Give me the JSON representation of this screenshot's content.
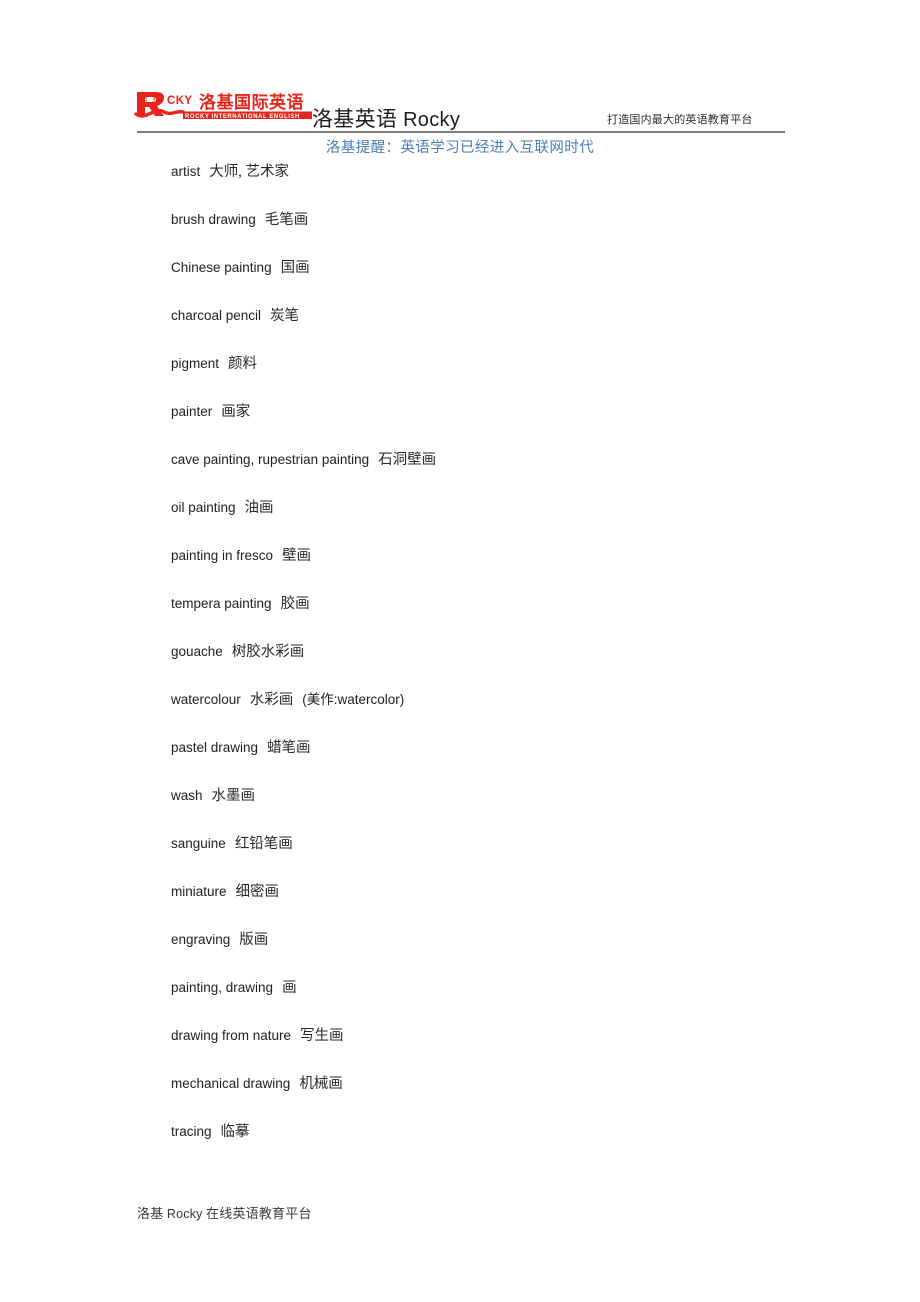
{
  "header": {
    "logo": {
      "icon": "rocky-logo-icon",
      "mark_letter": "R",
      "mark_suffix": "CKY",
      "chinese": "洛基国际英语",
      "english": "ROCKY INTERNATIONAL ENGLISH",
      "color": "#e8251c"
    },
    "brand_title_cn": "洛基英语",
    "brand_title_en": "Rocky",
    "tagline": "打造国内最大的英语教育平台",
    "subtitle": "洛基提醒：英语学习已经进入互联网时代",
    "subtitle_color": "#4a7fb5",
    "rule_color": "#7b7b78"
  },
  "entries": [
    {
      "en": "artist",
      "zh": "大师, 艺术家",
      "note": ""
    },
    {
      "en": "brush drawing",
      "zh": "毛笔画",
      "note": ""
    },
    {
      "en": "Chinese painting",
      "zh": "国画",
      "note": ""
    },
    {
      "en": "charcoal pencil",
      "zh": "炭笔",
      "note": ""
    },
    {
      "en": "pigment",
      "zh": "颜料",
      "note": ""
    },
    {
      "en": "painter",
      "zh": "画家",
      "note": ""
    },
    {
      "en": "cave painting, rupestrian painting",
      "zh": "石洞壁画",
      "note": ""
    },
    {
      "en": "oil painting",
      "zh": "油画",
      "note": ""
    },
    {
      "en": "painting in fresco",
      "zh": "壁画",
      "note": ""
    },
    {
      "en": "tempera painting",
      "zh": "胶画",
      "note": ""
    },
    {
      "en": "gouache",
      "zh": "树胶水彩画",
      "note": ""
    },
    {
      "en": "watercolour",
      "zh": "水彩画",
      "note": "(美作:watercolor)"
    },
    {
      "en": "pastel drawing",
      "zh": "蜡笔画",
      "note": ""
    },
    {
      "en": "wash",
      "zh": "水墨画",
      "note": ""
    },
    {
      "en": "sanguine",
      "zh": "红铅笔画",
      "note": ""
    },
    {
      "en": "miniature",
      "zh": "细密画",
      "note": ""
    },
    {
      "en": "engraving",
      "zh": "版画",
      "note": ""
    },
    {
      "en": "painting, drawing",
      "zh": "画",
      "note": ""
    },
    {
      "en": "drawing from nature",
      "zh": "写生画",
      "note": ""
    },
    {
      "en": "mechanical drawing",
      "zh": "机械画",
      "note": ""
    },
    {
      "en": "tracing",
      "zh": "临摹",
      "note": ""
    }
  ],
  "footer": {
    "text_cn_1": "洛基",
    "text_en": "Rocky",
    "text_cn_2": "在线英语教育平台"
  }
}
